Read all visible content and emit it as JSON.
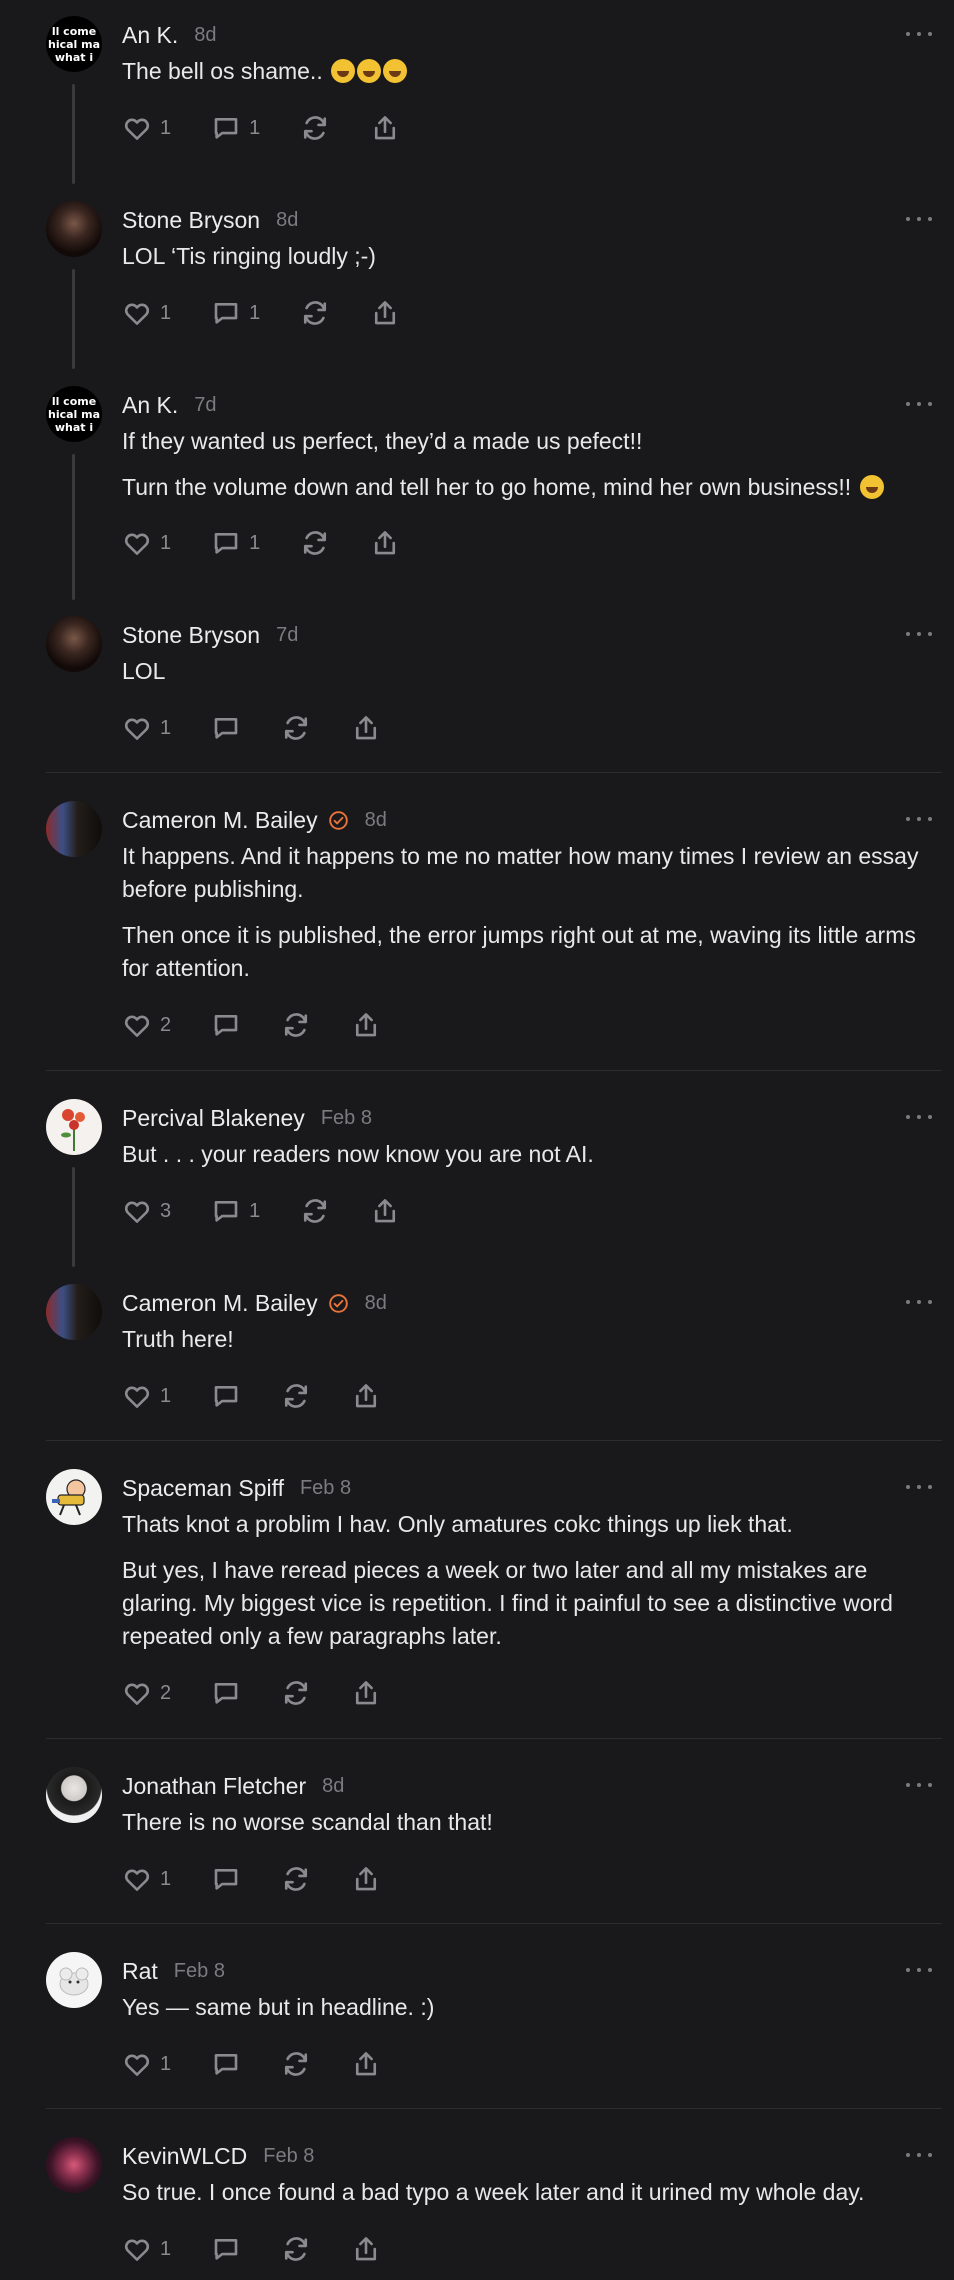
{
  "accent_color": "#e8743b",
  "comments": [
    {
      "author": "An K.",
      "time": "8d",
      "verified": false,
      "avatar": "text-badge-avatar",
      "paragraphs": [
        "The bell os shame.."
      ],
      "emoji_count": 3,
      "likes": "1",
      "replies": "1"
    },
    {
      "author": "Stone Bryson",
      "time": "8d",
      "verified": false,
      "avatar": "bearded-man-avatar",
      "paragraphs": [
        "LOL ‘Tis ringing loudly ;-)"
      ],
      "likes": "1",
      "replies": "1"
    },
    {
      "author": "An K.",
      "time": "7d",
      "verified": false,
      "avatar": "text-badge-avatar",
      "paragraphs": [
        "If they wanted us perfect, they’d a made us pefect!!",
        "Turn the volume down and tell her to go home, mind her own business!!"
      ],
      "emoji_count": 1,
      "likes": "1",
      "replies": "1"
    },
    {
      "author": "Stone Bryson",
      "time": "7d",
      "verified": false,
      "avatar": "bearded-man-avatar",
      "paragraphs": [
        "LOL"
      ],
      "likes": "1",
      "replies": ""
    },
    {
      "author": "Cameron M. Bailey",
      "time": "8d",
      "verified": true,
      "avatar": "man-flag-avatar",
      "paragraphs": [
        "It happens. And it happens to me no matter how many times I review an essay before publishing.",
        "Then once it is published, the error jumps right out at me, waving its little arms for attention."
      ],
      "likes": "2",
      "replies": ""
    },
    {
      "author": "Percival Blakeney",
      "time": "Feb 8",
      "verified": false,
      "avatar": "flower-avatar",
      "paragraphs": [
        "But . . . your readers now know you are not AI."
      ],
      "likes": "3",
      "replies": "1"
    },
    {
      "author": "Cameron M. Bailey",
      "time": "8d",
      "verified": true,
      "avatar": "man-flag-avatar",
      "paragraphs": [
        "Truth here!"
      ],
      "likes": "1",
      "replies": ""
    },
    {
      "author": "Spaceman Spiff",
      "time": "Feb 8",
      "verified": false,
      "avatar": "cartoon-avatar",
      "paragraphs": [
        "Thats knot a problim I hav. Only amatures cokc things up liek that.",
        "But yes, I have reread pieces a week or two later and all my mistakes are glaring. My biggest vice is repetition. I find it painful to see a distinctive word repeated only a few paragraphs later."
      ],
      "likes": "2",
      "replies": ""
    },
    {
      "author": "Jonathan Fletcher",
      "time": "8d",
      "verified": false,
      "avatar": "boy-portrait-avatar",
      "paragraphs": [
        "There is no worse scandal than that!"
      ],
      "likes": "1",
      "replies": ""
    },
    {
      "author": "Rat",
      "time": "Feb 8",
      "verified": false,
      "avatar": "rat-avatar",
      "paragraphs": [
        "Yes — same but in headline. :)"
      ],
      "likes": "1",
      "replies": ""
    },
    {
      "author": "KevinWLCD",
      "time": "Feb 8",
      "verified": false,
      "avatar": "nebula-avatar",
      "paragraphs": [
        "So true. I once found a bad typo a week later and it urined my whole day."
      ],
      "likes": "1",
      "replies": ""
    }
  ],
  "avatar_badge_text": [
    "ll come",
    "hical ma",
    "what i"
  ]
}
